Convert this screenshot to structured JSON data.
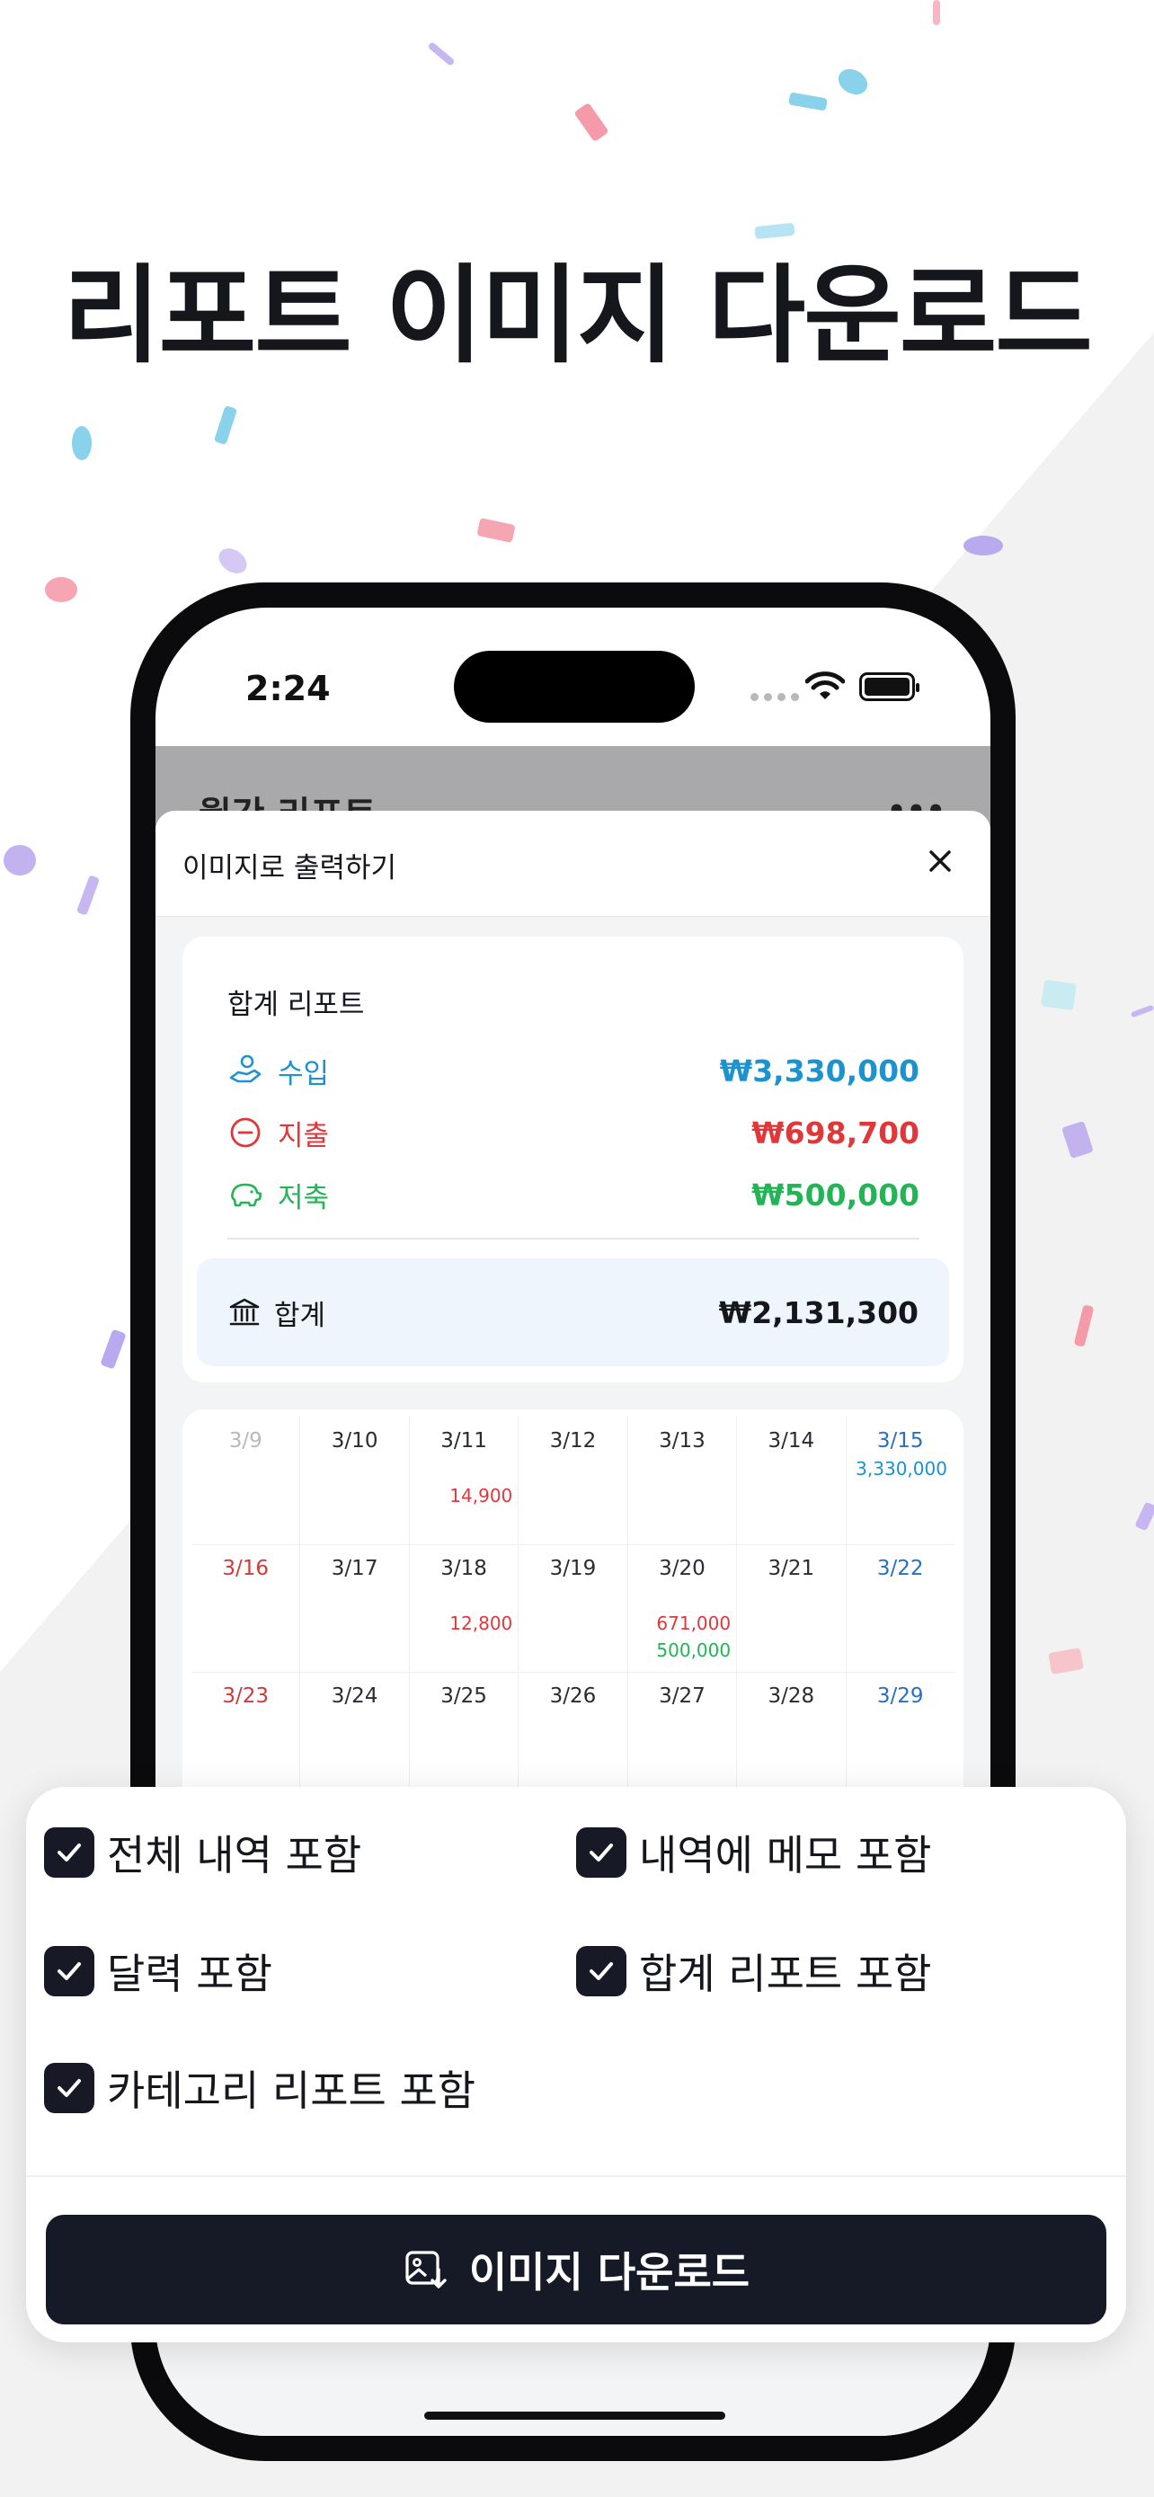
{
  "headline": "리포트 이미지 다운로드",
  "status_bar": {
    "time": "2:24"
  },
  "background_screen": {
    "title": "월간 리포트",
    "menu": "•••"
  },
  "sheet": {
    "title": "이미지로 출력하기",
    "summary": {
      "title": "합계 리포트",
      "income": {
        "label": "수입",
        "amount": "₩3,330,000"
      },
      "expense": {
        "label": "지출",
        "amount": "₩698,700"
      },
      "saving": {
        "label": "저축",
        "amount": "₩500,000"
      },
      "total": {
        "label": "합계",
        "amount": "₩2,131,300"
      }
    },
    "calendar": {
      "weeks": [
        [
          {
            "date": "3/9"
          },
          {
            "date": "3/10"
          },
          {
            "date": "3/11",
            "expense": "14,900"
          },
          {
            "date": "3/12"
          },
          {
            "date": "3/13"
          },
          {
            "date": "3/14"
          },
          {
            "date": "3/15",
            "income": "3,330,000"
          }
        ],
        [
          {
            "date": "3/16"
          },
          {
            "date": "3/17"
          },
          {
            "date": "3/18",
            "expense": "12,800"
          },
          {
            "date": "3/19"
          },
          {
            "date": "3/20",
            "expense": "671,000",
            "saving": "500,000"
          },
          {
            "date": "3/21"
          },
          {
            "date": "3/22"
          }
        ],
        [
          {
            "date": "3/23"
          },
          {
            "date": "3/24"
          },
          {
            "date": "3/25"
          },
          {
            "date": "3/26"
          },
          {
            "date": "3/27"
          },
          {
            "date": "3/28"
          },
          {
            "date": "3/29"
          }
        ]
      ]
    }
  },
  "options": {
    "all_history": "전체 내역 포함",
    "memo": "내역에 메모 포함",
    "calendar": "달력 포함",
    "summary": "합계 리포트 포함",
    "category": "카테고리 리포트 포함"
  },
  "download_button": "이미지 다운로드",
  "colors": {
    "income": "#1c93cf",
    "expense": "#e0383a",
    "saving": "#23b455",
    "sunday": "#d23a3a",
    "saturday": "#2a6fc1",
    "muted": "#b7b9bf",
    "button": "#161a26"
  }
}
